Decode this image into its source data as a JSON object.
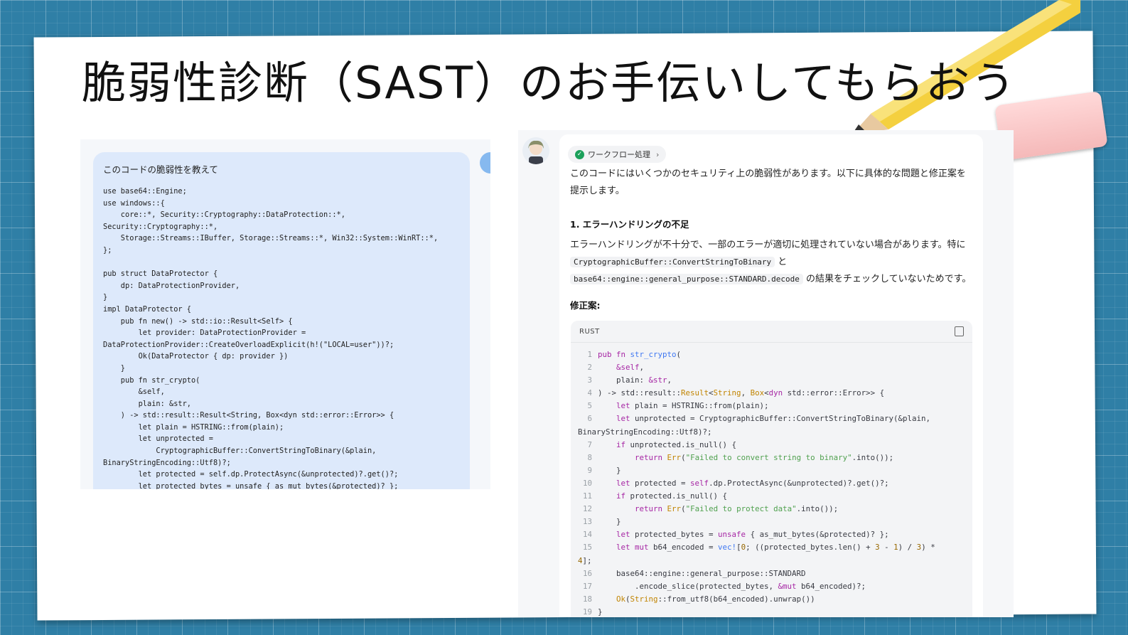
{
  "slide": {
    "title": "脆弱性診断（SAST）のお手伝いしてもらおう"
  },
  "left_panel": {
    "question": "このコードの脆弱性を教えて",
    "code": "use base64::Engine;\nuse windows::{\n    core::*, Security::Cryptography::DataProtection::*,\nSecurity::Cryptography::*,\n    Storage::Streams::IBuffer, Storage::Streams::*, Win32::System::WinRT::*,\n};\n\npub struct DataProtector {\n    dp: DataProtectionProvider,\n}\nimpl DataProtector {\n    pub fn new() -> std::io::Result<Self> {\n        let provider: DataProtectionProvider =\nDataProtectionProvider::CreateOverloadExplicit(h!(\"LOCAL=user\"))?;\n        Ok(DataProtector { dp: provider })\n    }\n    pub fn str_crypto(\n        &self,\n        plain: &str,\n    ) -> std::result::Result<String, Box<dyn std::error::Error>> {\n        let plain = HSTRING::from(plain);\n        let unprotected =\n            CryptographicBuffer::ConvertStringToBinary(&plain,\nBinaryStringEncoding::Utf8)?;\n        let protected = self.dp.ProtectAsync(&unprotected)?.get()?;\n        let protected_bytes = unsafe { as_mut_bytes(&protected)? };"
  },
  "right_panel": {
    "workflow_label": "ワークフロー処理",
    "intro": "このコードにはいくつかのセキュリティ上の脆弱性があります。以下に具体的な問題と修正案を提示します。",
    "heading": "1. エラーハンドリングの不足",
    "body_prefix": "エラーハンドリングが不十分で、一部のエラーが適切に処理されていない場合があります。特に",
    "code_ref_1": "CryptographicBuffer::ConvertStringToBinary",
    "connector": "と",
    "code_ref_2": "base64::engine::general_purpose::STANDARD.decode",
    "body_suffix": "の結果をチェックしていないためです。",
    "fix_label": "修正案:",
    "code_lang": "RUST",
    "line_numbers": [
      "1",
      "2",
      "3",
      "4",
      "5",
      "6",
      "",
      "7",
      "8",
      "9",
      "10",
      "11",
      "12",
      "13",
      "14",
      "15",
      "",
      "16",
      "17",
      "18",
      "19"
    ]
  },
  "colors": {
    "background": "#2f7fa6",
    "user_bubble": "#dde9fb",
    "check_green": "#1ba05a",
    "keyword": "#a626a4",
    "type": "#c18401",
    "string": "#50a14f",
    "function": "#4078f2"
  },
  "icons": [
    "pencil-icon",
    "eraser-icon",
    "check-icon",
    "chevron-right-icon",
    "copy-icon",
    "bot-avatar",
    "user-avatar"
  ]
}
